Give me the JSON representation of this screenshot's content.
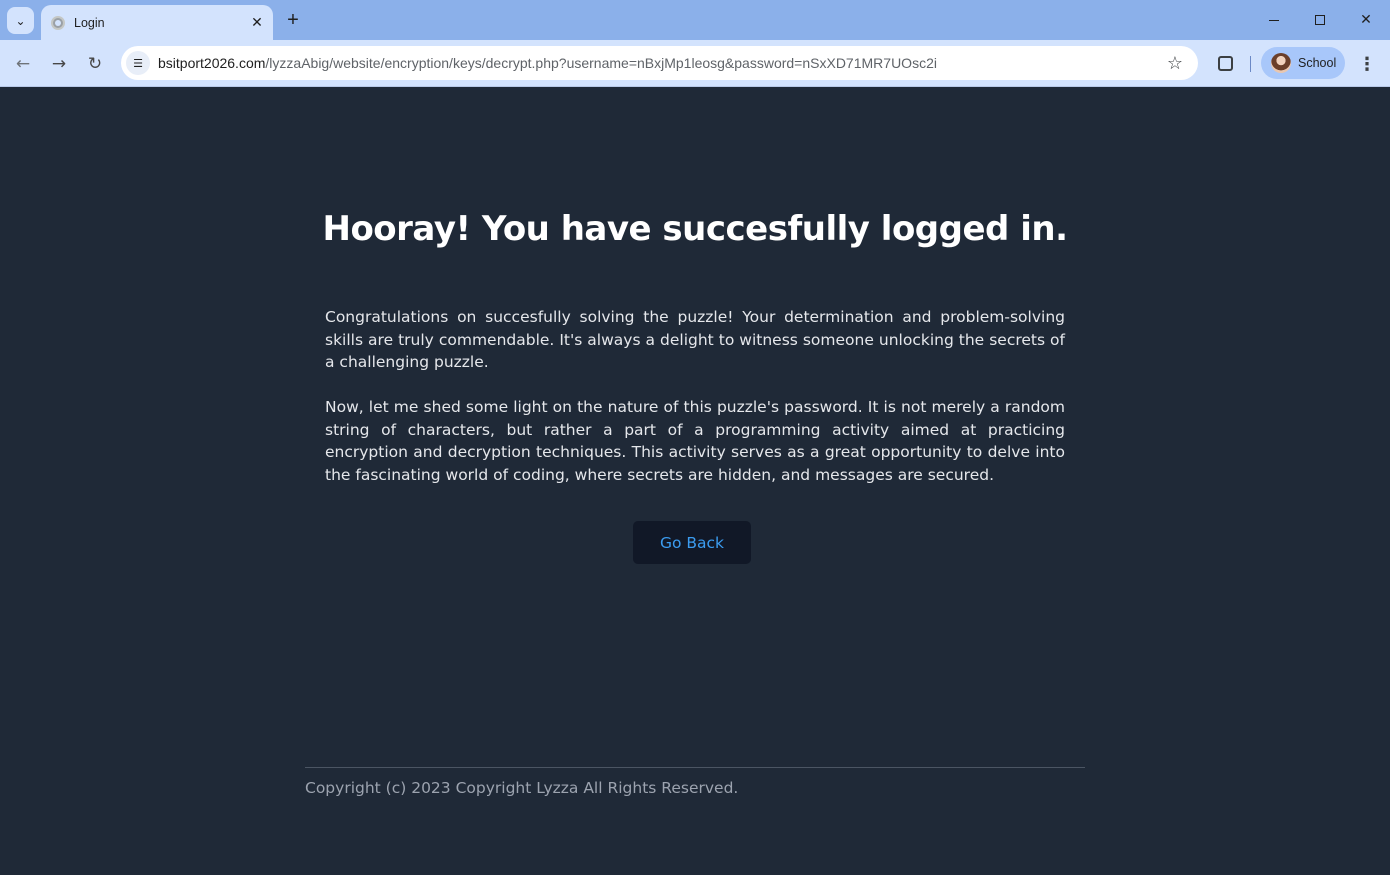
{
  "browser": {
    "tab": {
      "title": "Login"
    },
    "address_bar": {
      "host": "bsitport2026.com",
      "path": "/lyzzaAbig/website/encryption/keys/decrypt.php?username=nBxjMp1leosg&password=nSxXD71MR7UOsc2i"
    },
    "profile": {
      "label": "School"
    },
    "icons": {
      "tab_search": "chevron-down-icon",
      "favicon": "globe-icon",
      "tab_close": "close-icon",
      "new_tab": "plus-icon",
      "back": "arrow-left-icon",
      "forward": "arrow-right-icon",
      "reload": "reload-icon",
      "site_info": "tune-icon",
      "bookmark": "star-icon",
      "extensions": "puzzle-icon",
      "menu": "kebab-menu-icon"
    }
  },
  "page": {
    "headline": "Hooray! You have succesfully logged in.",
    "paragraphs": [
      "Congratulations on succesfully solving the puzzle! Your determination and problem-solving skills are truly commendable. It's always a delight to witness someone unlocking the secrets of a challenging puzzle.",
      "Now, let me shed some light on the nature of this puzzle's password. It is not merely a random string of characters, but rather a part of a programming activity aimed at practicing encryption and decryption techniques. This activity serves as a great opportunity to delve into the fascinating world of coding, where secrets are hidden, and messages are secured."
    ],
    "go_back_label": "Go Back",
    "footer": "Copyright (c) 2023 Copyright Lyzza All Rights Reserved."
  },
  "colors": {
    "page_background": "#1f2937",
    "button_background": "#111827",
    "button_text": "#3b9cf0",
    "chrome_tabstrip": "#8bb0ea",
    "chrome_toolbar": "#d3e3fd"
  }
}
